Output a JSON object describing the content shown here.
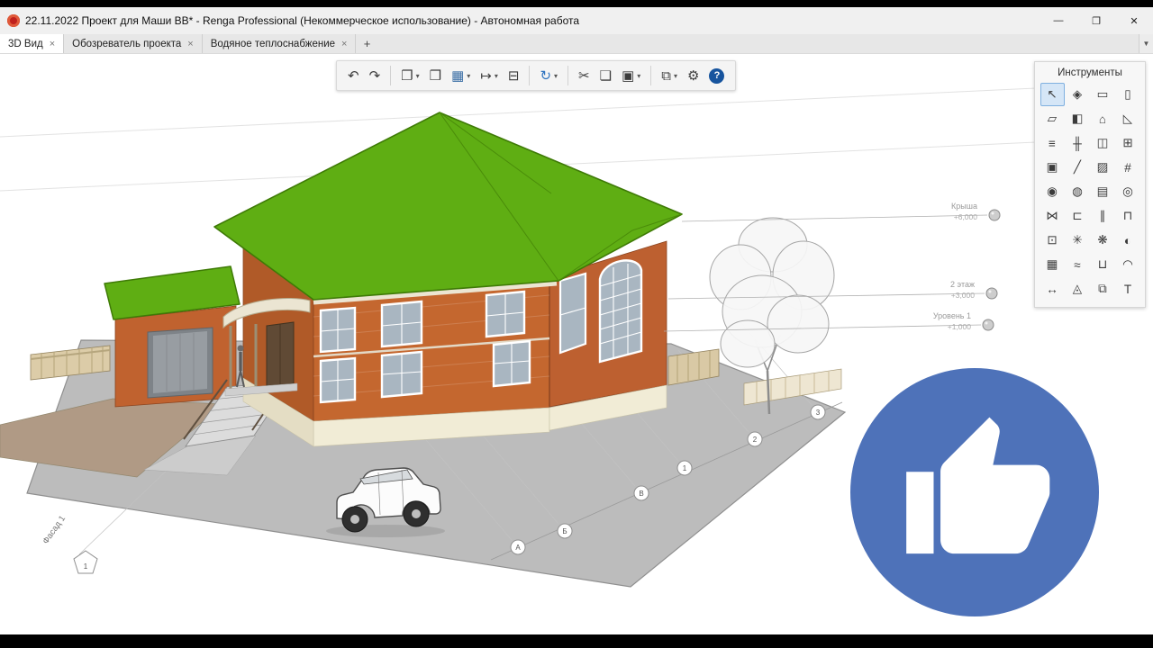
{
  "window": {
    "title": "22.11.2022 Проект для Маши ВВ* - Renga Professional (Некоммерческое использование) - Автономная работа",
    "controls": {
      "minimize": "—",
      "maximize": "❐",
      "close": "✕"
    }
  },
  "tabs": {
    "items": [
      {
        "label": "3D Вид"
      },
      {
        "label": "Обозреватель проекта"
      },
      {
        "label": "Водяное теплоснабжение"
      }
    ],
    "close_glyph": "×",
    "new_tab": "+",
    "scroll_glyph": "▼"
  },
  "toolbar": {
    "items": [
      {
        "type": "button",
        "name": "undo",
        "glyph": "↶"
      },
      {
        "type": "button",
        "name": "redo",
        "glyph": "↷"
      },
      {
        "type": "sep"
      },
      {
        "type": "button",
        "name": "copy-visual-style",
        "glyph": "❐",
        "dropdown": true
      },
      {
        "type": "button",
        "name": "open-project",
        "glyph": "❒"
      },
      {
        "type": "button",
        "name": "save-project",
        "glyph": "▦",
        "dropdown": true,
        "color": "#3a6ea5"
      },
      {
        "type": "button",
        "name": "export",
        "glyph": "↦",
        "dropdown": true
      },
      {
        "type": "button",
        "name": "print",
        "glyph": "⊟"
      },
      {
        "type": "sep"
      },
      {
        "type": "button",
        "name": "collaboration-sync",
        "glyph": "↻",
        "dropdown": true,
        "color": "#2f74c0"
      },
      {
        "type": "sep"
      },
      {
        "type": "button",
        "name": "cut",
        "glyph": "✂"
      },
      {
        "type": "button",
        "name": "copy",
        "glyph": "❏"
      },
      {
        "type": "button",
        "name": "paste",
        "glyph": "▣",
        "dropdown": true
      },
      {
        "type": "sep"
      },
      {
        "type": "button",
        "name": "drawings",
        "glyph": "⧉",
        "dropdown": true
      },
      {
        "type": "button",
        "name": "settings",
        "glyph": "⚙"
      },
      {
        "type": "button",
        "name": "help",
        "glyph": "?",
        "help": true
      }
    ]
  },
  "tools_panel": {
    "title": "Инструменты",
    "tools": [
      {
        "name": "select",
        "glyph": "↖"
      },
      {
        "name": "measure",
        "glyph": "◈"
      },
      {
        "name": "wall",
        "glyph": "▭"
      },
      {
        "name": "column",
        "glyph": "▯"
      },
      {
        "name": "beam",
        "glyph": "▱"
      },
      {
        "name": "floor",
        "glyph": "◧"
      },
      {
        "name": "roof",
        "glyph": "⌂"
      },
      {
        "name": "ramp",
        "glyph": "◺"
      },
      {
        "name": "stair",
        "glyph": "≡"
      },
      {
        "name": "railing",
        "glyph": "╫"
      },
      {
        "name": "door",
        "glyph": "◫"
      },
      {
        "name": "window",
        "glyph": "⊞"
      },
      {
        "name": "opening",
        "glyph": "▣"
      },
      {
        "name": "line",
        "glyph": "╱"
      },
      {
        "name": "hatch",
        "glyph": "▨"
      },
      {
        "name": "grid",
        "glyph": "#"
      },
      {
        "name": "plumbing-fixture",
        "glyph": "◉"
      },
      {
        "name": "sanitary",
        "glyph": "◍"
      },
      {
        "name": "radiator",
        "glyph": "▤"
      },
      {
        "name": "pump",
        "glyph": "◎"
      },
      {
        "name": "valve",
        "glyph": "⋈"
      },
      {
        "name": "duct",
        "glyph": "⊏"
      },
      {
        "name": "pipe",
        "glyph": "∥"
      },
      {
        "name": "fitting",
        "glyph": "⊓"
      },
      {
        "name": "equipment",
        "glyph": "⊡"
      },
      {
        "name": "lamp",
        "glyph": "✳"
      },
      {
        "name": "sprinkler",
        "glyph": "❋"
      },
      {
        "name": "sensor",
        "glyph": "◐"
      },
      {
        "name": "electric-panel",
        "glyph": "▦"
      },
      {
        "name": "cable",
        "glyph": "≈"
      },
      {
        "name": "tray",
        "glyph": "⊔"
      },
      {
        "name": "arc",
        "glyph": "◠"
      },
      {
        "name": "dimension",
        "glyph": "↔"
      },
      {
        "name": "axis",
        "glyph": "◬"
      },
      {
        "name": "assembly",
        "glyph": "⧉"
      },
      {
        "name": "text",
        "glyph": "T"
      }
    ]
  },
  "scene": {
    "levels": [
      {
        "name": "Крыша",
        "elevation": "+6,000"
      },
      {
        "name": "2 этаж",
        "elevation": "+3,000"
      },
      {
        "name": "Уровень 1",
        "elevation": "+1,000"
      }
    ],
    "axes": {
      "letters": [
        "А",
        "Б",
        "В"
      ],
      "numbers": [
        "1",
        "2",
        "3"
      ]
    },
    "facade_label": "Фасад 1",
    "facade_marker": "1",
    "colors": {
      "roof": "#5fae13",
      "brick": "#c4672f",
      "ground": "#bcbcbc",
      "like": "#4e72b9"
    }
  }
}
